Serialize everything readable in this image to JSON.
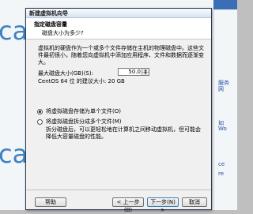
{
  "background": {
    "brand_top": "catio",
    "brand_bottom": "catio",
    "side_links": [
      "服务",
      "网",
      "如",
      "Wo",
      "ce",
      "re"
    ]
  },
  "dialog": {
    "title": "新建虚拟机向导",
    "header_title": "指定磁盘容量",
    "header_subtitle": "磁盘大小为多少?",
    "description": "虚拟机的硬盘作为一个或多个文件存储在主机的物理磁盘中。这些文件最初很小，随着您向虚拟机中添加应用程序、文件和数据而逐渐变大。",
    "max_disk_label": "最大磁盘大小(GB)(S):",
    "max_disk_value": "50.0",
    "recommended": "CentOS 64 位 的建议大小: 20 GB",
    "radio_single": "将虚拟磁盘存储为单个文件(O)",
    "radio_multi": "将虚拟磁盘拆分成多个文件(M)",
    "radio_note": "拆分磁盘后，可以更轻松地在计算机之间移动虚拟机，但可能会降低大容量磁盘的性能。",
    "buttons": {
      "help": "帮助",
      "back": "< 上一步(B)",
      "next": "下一步(N) >",
      "cancel": "取消"
    }
  },
  "colors": {
    "brand": "#3c82c4",
    "dialog_bg": "#f0f0f0",
    "header_bg": "#ffffff"
  }
}
